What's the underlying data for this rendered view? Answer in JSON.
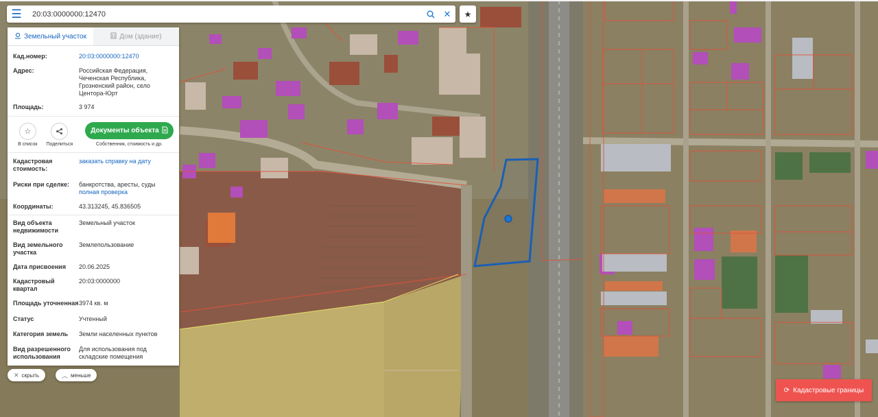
{
  "search": {
    "value": "20:03:0000000:12470"
  },
  "icons": {
    "menu": "hamburger-icon",
    "search": "search-icon",
    "clear": "close-icon",
    "favorite": "star-icon",
    "land": "land-plot-icon",
    "building": "building-icon",
    "share": "share-icon",
    "document": "document-icon",
    "collapse": "close-icon",
    "chevron": "chevron-up-icon",
    "refresh": "refresh-icon"
  },
  "tabs": [
    {
      "label": "Земельный участок",
      "active": true
    },
    {
      "label": "Дом (здание)",
      "active": false
    }
  ],
  "parcel": {
    "cad_label": "Кад.номер:",
    "cad_value": "20:03:0000000:12470",
    "address_label": "Адрес:",
    "address_value": "Российская Федерация, Чеченская Республика, Грозненский район, село Центора-Юрт",
    "area_label": "Площадь:",
    "area_value": "3 974"
  },
  "actions": {
    "favorite_caption": "В список",
    "share_caption": "Поделиться",
    "docs_label": "Документы объекта",
    "docs_caption": "Собственник, стоимость и др."
  },
  "details": {
    "cost_label": "Кадастровая стоимость:",
    "cost_link": "заказать справку на дату",
    "risks_label": "Риски при сделке:",
    "risks_text": "банкротства, аресты, суды",
    "risks_link": "полная проверка",
    "coords_label": "Координаты:",
    "coords_value": "43.313245, 45.836505"
  },
  "attributes": [
    {
      "label": "Вид объекта недвижимости",
      "value": "Земельный участок"
    },
    {
      "label": "Вид земельного участка",
      "value": "Землепользование"
    },
    {
      "label": "Дата присвоения",
      "value": "20.06.2025"
    },
    {
      "label": "Кадастровый квартал",
      "value": "20:03:0000000"
    },
    {
      "label": "Площадь уточненная",
      "value": "3974 кв. м"
    },
    {
      "label": "Статус",
      "value": "Учтенный"
    },
    {
      "label": "Категория земель",
      "value": "Земли населенных пунктов"
    },
    {
      "label": "Вид разрешенного использования",
      "value": "Для использования под складские помещения"
    }
  ],
  "chips": {
    "hide": "скрыть",
    "less": "меньше"
  },
  "cadastral_button": "Кадастровые границы",
  "colors": {
    "accent": "#1565c0",
    "docs_button": "#2fa94e",
    "cadastral_button": "#ef5350",
    "parcel_outline": "#1a5fb4"
  }
}
